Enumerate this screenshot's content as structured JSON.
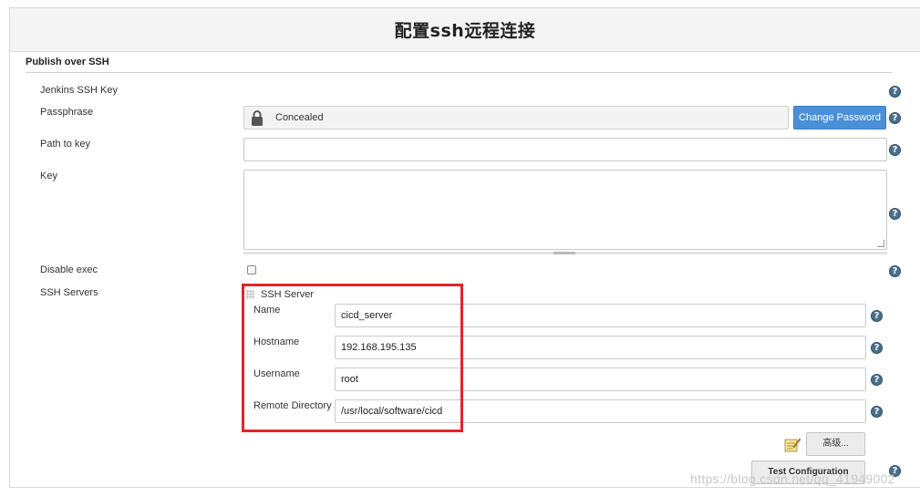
{
  "header": {
    "title": "配置ssh远程连接"
  },
  "section": {
    "title": "Publish over SSH"
  },
  "fields": {
    "jenkins_ssh_key": {
      "label": "Jenkins SSH Key"
    },
    "passphrase": {
      "label": "Passphrase",
      "value": "Concealed",
      "button_label": "Change Password"
    },
    "path_to_key": {
      "label": "Path to key",
      "value": ""
    },
    "key": {
      "label": "Key",
      "value": ""
    },
    "disable_exec": {
      "label": "Disable exec",
      "checked": false
    },
    "ssh_servers": {
      "label": "SSH Servers"
    }
  },
  "ssh_server": {
    "heading": "SSH Server",
    "name": {
      "label": "Name",
      "value": "cicd_server"
    },
    "hostname": {
      "label": "Hostname",
      "value": "192.168.195.135"
    },
    "username": {
      "label": "Username",
      "value": "root"
    },
    "remote_directory": {
      "label": "Remote Directory",
      "value": "/usr/local/software/cicd"
    },
    "advanced_button": "高级...",
    "test_button": "Test Configuration"
  },
  "icons": {
    "help": "help-icon",
    "lock": "lock-icon",
    "notepad": "notepad-icon",
    "drag": "drag-handle-icon"
  },
  "colors": {
    "accent_blue": "#4a90d9",
    "highlight_red": "#e0262b",
    "help_icon": "#4a6f8f"
  },
  "watermark": "https://blog.csdn.net/qq_41949002"
}
